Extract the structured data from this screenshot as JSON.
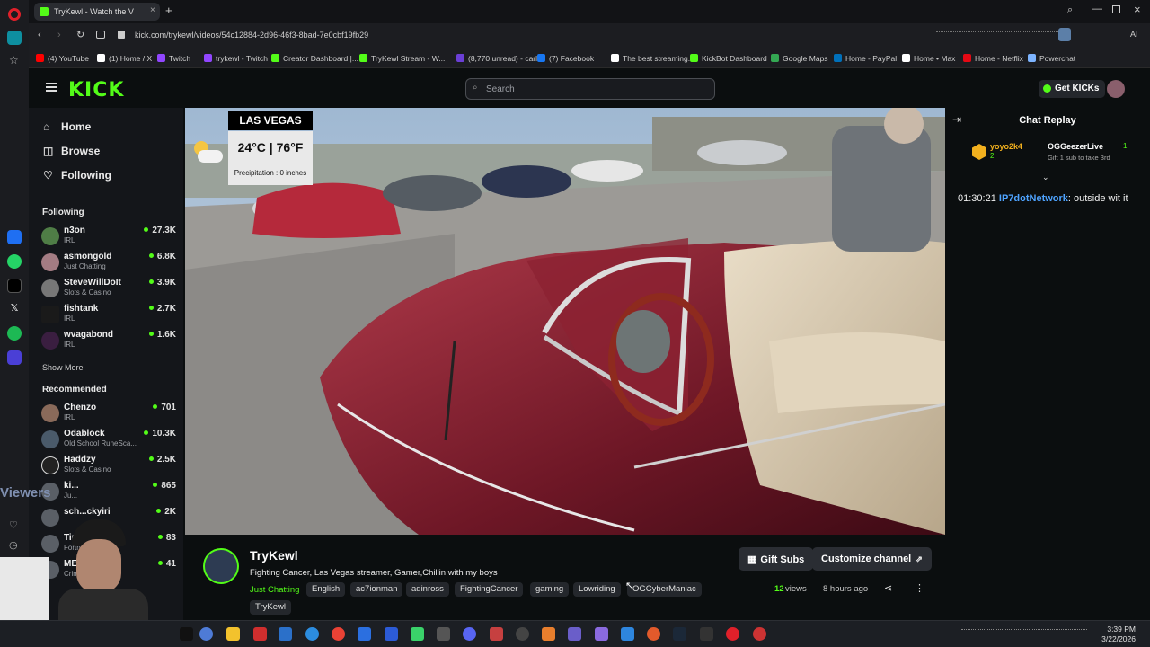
{
  "browser": {
    "tab_title": "TryKewl - Watch the V",
    "url": "kick.com/trykewl/videos/54c12884-2d96-46f3-8bad-7e0cbf19fb29",
    "bookmarks": [
      {
        "label": "(4) YouTube",
        "color": "#ff0000"
      },
      {
        "label": "(1) Home / X",
        "color": "#ffffff"
      },
      {
        "label": "Twitch",
        "color": "#9146ff"
      },
      {
        "label": "trykewl - Twitch",
        "color": "#9146ff"
      },
      {
        "label": "Creator Dashboard |...",
        "color": "#53fc18"
      },
      {
        "label": "TryKewl Stream - W...",
        "color": "#53fc18"
      },
      {
        "label": "(8,770 unread) - carl...",
        "color": "#6b3fd6"
      },
      {
        "label": "(7) Facebook",
        "color": "#1877f2"
      },
      {
        "label": "The best streaming...",
        "color": "#ffffff"
      },
      {
        "label": "KickBot Dashboard",
        "color": "#53fc18"
      },
      {
        "label": "Google Maps",
        "color": "#34a853"
      },
      {
        "label": "Home - PayPal",
        "color": "#0070ba"
      },
      {
        "label": "Home • Max",
        "color": "#ffffff"
      },
      {
        "label": "Home - Netflix",
        "color": "#e50914"
      },
      {
        "label": "Powerchat",
        "color": "#7db4ff"
      }
    ]
  },
  "header": {
    "logo": "KICK",
    "search_placeholder": "Search",
    "get_kicks": "Get KICKs"
  },
  "sidebar": {
    "nav": [
      {
        "label": "Home",
        "icon": "home-icon"
      },
      {
        "label": "Browse",
        "icon": "browse-icon"
      },
      {
        "label": "Following",
        "icon": "heart-icon"
      }
    ],
    "following_title": "Following",
    "following": [
      {
        "name": "n3on",
        "category": "IRL",
        "viewers": "27.3K"
      },
      {
        "name": "asmongold",
        "category": "Just Chatting",
        "viewers": "6.8K"
      },
      {
        "name": "SteveWillDoIt",
        "category": "Slots & Casino",
        "viewers": "3.9K"
      },
      {
        "name": "fishtank",
        "category": "IRL",
        "viewers": "2.7K"
      },
      {
        "name": "wvagabond",
        "category": "IRL",
        "viewers": "1.6K"
      }
    ],
    "show_more": "Show More",
    "recommended_title": "Recommended",
    "recommended": [
      {
        "name": "Chenzo",
        "category": "IRL",
        "viewers": "701"
      },
      {
        "name": "Odablock",
        "category": "Old School RuneSca...",
        "viewers": "10.3K"
      },
      {
        "name": "Haddzy",
        "category": "Slots & Casino",
        "viewers": "2.5K"
      },
      {
        "name": "ki...",
        "category": "Ju...",
        "viewers": "865"
      },
      {
        "name": "sch...ckyiri",
        "category": "",
        "viewers": "2K"
      },
      {
        "name": "Tinyo",
        "category": "Fortnit...",
        "viewers": "83"
      },
      {
        "name": "MERP...",
        "category": "Crim...",
        "viewers": "41"
      }
    ]
  },
  "weather": {
    "city": "LAS VEGAS",
    "temp": "24°C | 76°F",
    "precip": "Precipitation : 0 inches"
  },
  "chat": {
    "title": "Chat Replay",
    "sub_user1": "yoyo2k4",
    "sub_user1_count": "2",
    "sub_user2": "OGGeezerLive",
    "sub_user2_count": "1",
    "sub_note": "Gift 1 sub to take 3rd",
    "message_time": "01:30:21",
    "message_user": "IP7dotNetwork",
    "message_text": ": outside wit it"
  },
  "channel": {
    "name": "TryKewl",
    "title": "Fighting Cancer, Las Vegas streamer, Gamer,Chillin with my boys",
    "category": "Just Chatting",
    "tags": [
      "English",
      "ac7ionman",
      "adinross",
      "FightingCancer",
      "gaming",
      "Lowriding",
      "OGCyberManiac",
      "TryKewl"
    ],
    "gift_subs": "Gift Subs",
    "customize": "Customize channel",
    "views_count": "12",
    "views_label": "views",
    "time_ago": "8 hours ago"
  },
  "taskbar": {
    "time": "3:39 PM",
    "date": "3/22/2026"
  },
  "overlay": {
    "viewers_text": "Viewers"
  },
  "colors": {
    "kick_green": "#53fc18",
    "chat_user": "#4ea3ff"
  }
}
